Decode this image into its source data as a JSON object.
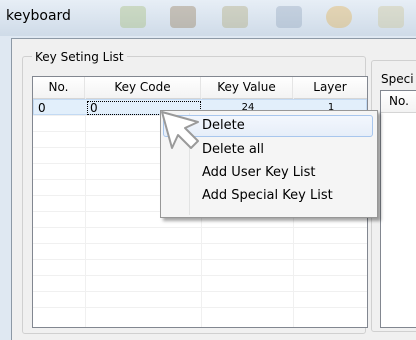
{
  "window": {
    "title": "keyboard"
  },
  "key_list": {
    "group_label": "Key Seting List",
    "columns": [
      "No.",
      "Key Code",
      "Key Value",
      "Layer"
    ],
    "rows": [
      {
        "no": "0",
        "key_code": "0",
        "key_value": "24",
        "layer": "1"
      }
    ]
  },
  "special_list": {
    "group_label": "Speci",
    "columns": [
      "No."
    ]
  },
  "context_menu": {
    "items": [
      "Delete",
      "Delete all",
      "Add User Key List",
      "Add Special Key List"
    ]
  },
  "icons": {
    "cursor": "arrow-cursor-icon"
  }
}
